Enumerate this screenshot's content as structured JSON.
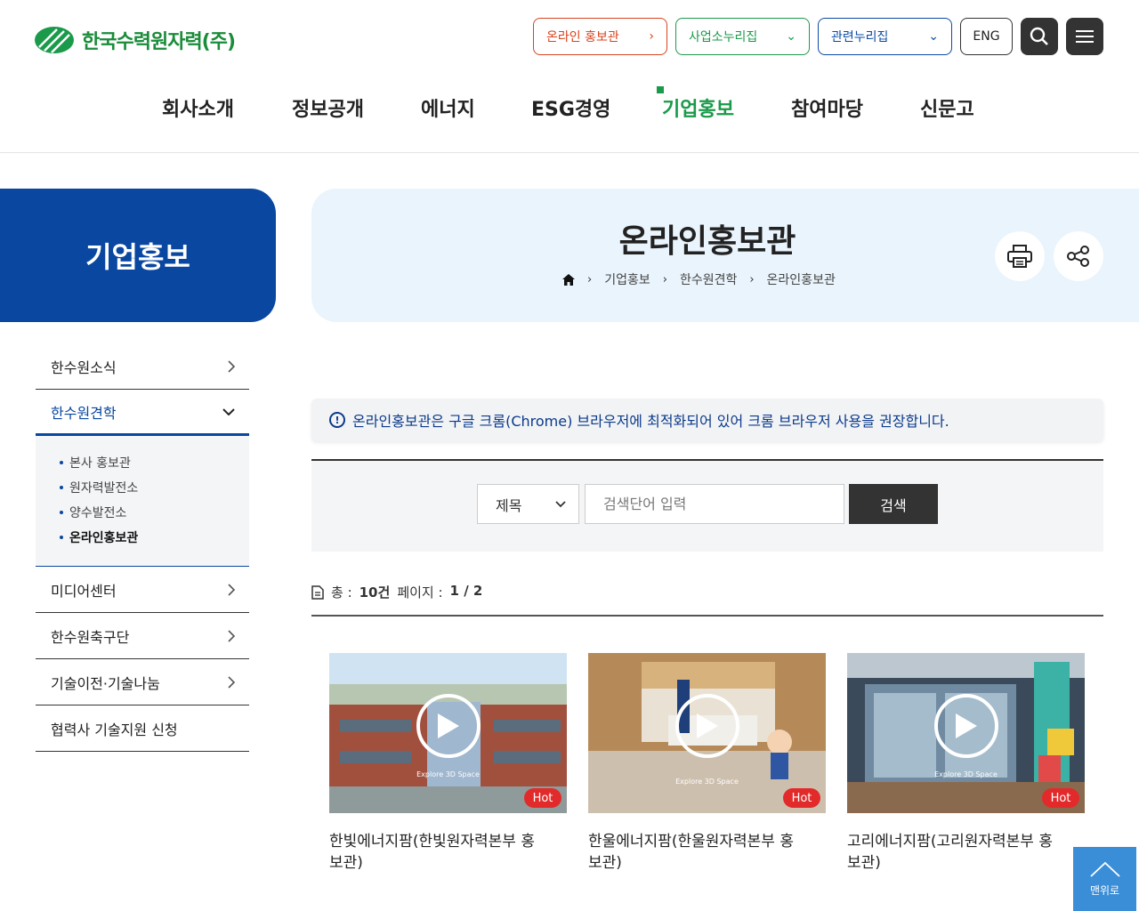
{
  "header": {
    "logo_text": "한국수력원자력(주)",
    "util": {
      "online": "온라인 홍보관",
      "biz": "사업소누리집",
      "related": "관련누리집",
      "eng": "ENG"
    },
    "gnb": [
      "회사소개",
      "정보공개",
      "에너지",
      "ESG경영",
      "기업홍보",
      "참여마당",
      "신문고"
    ]
  },
  "side": {
    "title": "기업홍보",
    "menu": {
      "item1": "한수원소식",
      "item2": "한수원견학",
      "sub": [
        "본사 홍보관",
        "원자력발전소",
        "양수발전소",
        "온라인홍보관"
      ],
      "item3": "미디어센터",
      "item4": "한수원축구단",
      "item5": "기술이전·기술나눔",
      "item6": "협력사 기술지원 신청"
    }
  },
  "page": {
    "title": "온라인홍보관",
    "breadcrumb": [
      "기업홍보",
      "한수원견학",
      "온라인홍보관"
    ]
  },
  "notice": "온라인홍보관은 구글 크롬(Chrome) 브라우저에 최적화되어 있어 크롬 브라우저 사용을 권장합니다.",
  "search": {
    "select_value": "제목",
    "placeholder": "검색단어 입력",
    "button": "검색"
  },
  "count": {
    "total_label": "총 :",
    "total_value": "10건",
    "page_label": "페이지 :",
    "page_value": "1 / 2"
  },
  "cards": [
    {
      "title": "한빛에너지팜(한빛원자력본부 홍보관)",
      "badge": "Hot",
      "overlay": "Explore 3D Space"
    },
    {
      "title": "한울에너지팜(한울원자력본부 홍보관)",
      "badge": "Hot",
      "overlay": "Explore 3D Space"
    },
    {
      "title": "고리에너지팜(고리원자력본부 홍보관)",
      "badge": "Hot",
      "overlay": "Explore 3D Space"
    }
  ],
  "top_button": "맨위로",
  "colors": {
    "brand_blue": "#0a47a0",
    "brand_green": "#1a9a4a",
    "accent_orange": "#d9431e",
    "hot_red": "#e22a2a"
  }
}
